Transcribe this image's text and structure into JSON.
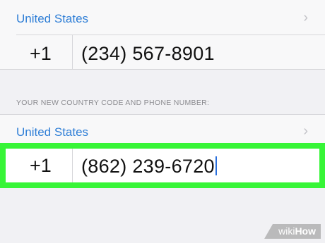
{
  "current": {
    "country": "United States",
    "code": "+1",
    "number": "(234) 567-8901"
  },
  "section_header": "YOUR NEW COUNTRY CODE AND PHONE NUMBER:",
  "new": {
    "country": "United States",
    "code": "+1",
    "number": "(862) 239-6720"
  },
  "highlight_color": "#37f537",
  "watermark": {
    "prefix": "wiki",
    "suffix": "How"
  }
}
